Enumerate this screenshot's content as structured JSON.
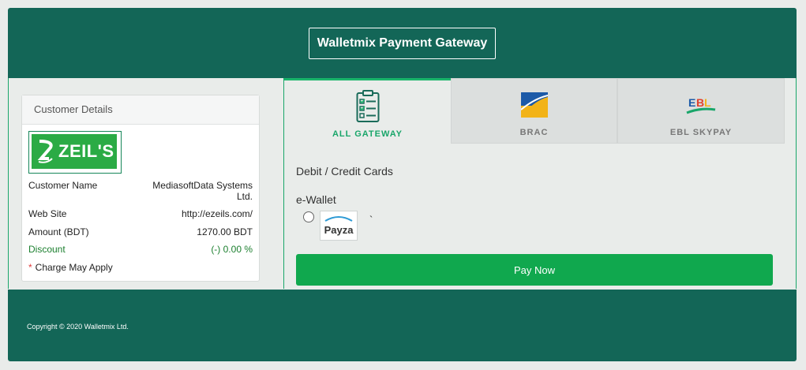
{
  "header": {
    "title": "Walletmix Payment Gateway"
  },
  "customer": {
    "heading": "Customer Details",
    "logo_text": "ZEIL'S",
    "rows": [
      {
        "label": "Customer Name",
        "value_line1": "MediasoftData Systems",
        "value_line2": "Ltd."
      },
      {
        "label": "Web Site",
        "value": "http://ezeils.com/"
      },
      {
        "label": "Amount (BDT)",
        "value": "1270.00 BDT"
      },
      {
        "label": "Discount",
        "value": "(-) 0.00 %"
      }
    ],
    "charge_star": "*",
    "charge_note": "Charge May Apply"
  },
  "tabs": [
    {
      "label": "ALL GATEWAY",
      "icon": "checklist-icon",
      "active": true
    },
    {
      "label": "BRAC",
      "icon": "brac-bank-logo-icon",
      "active": false
    },
    {
      "label": "EBL SKYPAY",
      "icon": "ebl-skypay-logo-icon",
      "active": false
    }
  ],
  "payment": {
    "cards_title": "Debit / Credit Cards",
    "ewallet_title": "e-Wallet",
    "ewallet_option": "Payza",
    "stray_mark": "`",
    "pay_button": "Pay Now"
  },
  "footer": {
    "copyright": "Copyright © 2020 Walletmix Ltd."
  },
  "colors": {
    "brand_dark": "#136657",
    "accent_green": "#19a66a",
    "button_green": "#10a84e"
  }
}
